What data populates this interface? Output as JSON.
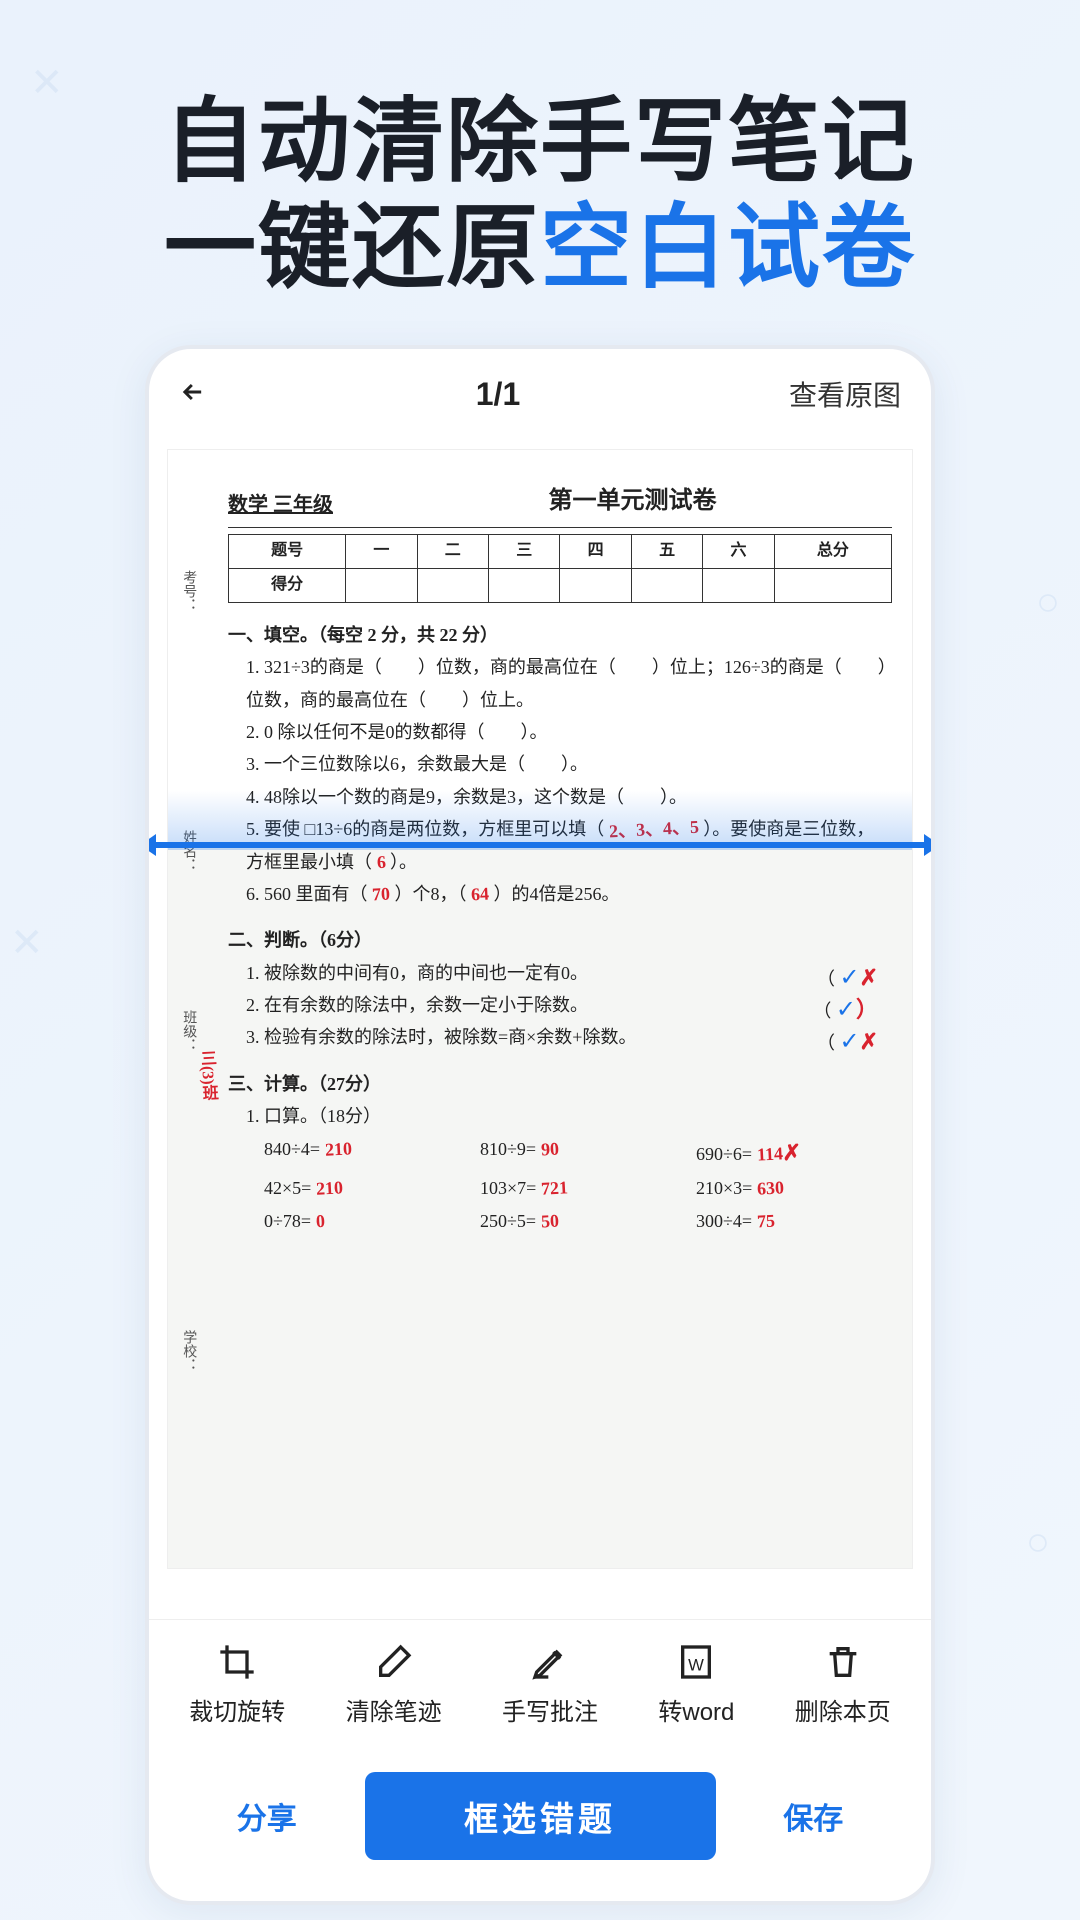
{
  "headline": {
    "line1": "自动清除手写笔记",
    "line2_pre": "一键还原",
    "line2_accent": "空白试卷"
  },
  "topbar": {
    "page_counter": "1/1",
    "view_original": "查看原图"
  },
  "document": {
    "subject": "数学 三年级",
    "unit_title": "第一单元测试卷",
    "score_headers": [
      "题号",
      "一",
      "二",
      "三",
      "四",
      "五",
      "六",
      "总分"
    ],
    "score_row_label": "得分",
    "side": {
      "xuehao": "考号：",
      "xingming": "姓名：",
      "banji": "班级：",
      "xuexiao": "学校：",
      "class_val": "三(3)班"
    },
    "sec1": {
      "title": "一、填空。（每空 2 分，共 22 分）",
      "q1": "1. 321÷3的商是（　　）位数，商的最高位在（　　）位上；126÷3的商是（　　）位数，商的最高位在（　　）位上。",
      "q2": "2. 0 除以任何不是0的数都得（　　）。",
      "q3": "3. 一个三位数除以6，余数最大是（　　）。",
      "q4": "4. 48除以一个数的商是9，余数是3，这个数是（　　）。",
      "q5_a": "5. 要使 □13÷6的商是两位数，方框里可以填（",
      "q5_b": "）。要使商是三位数，方框里最小填（",
      "q5_c": "）。",
      "q6_a": "6. 560 里面有（",
      "q6_b": "）个8，（",
      "q6_c": "）的4倍是256。",
      "hand_q5_fill": "2、3、4、5",
      "hand_q5_min": "6",
      "hand_q6_a": "70",
      "hand_q6_b": "64"
    },
    "sec2": {
      "title": "二、判断。（6分）",
      "q1": "1. 被除数的中间有0，商的中间也一定有0。",
      "q2": "2. 在有余数的除法中，余数一定小于除数。",
      "q3": "3. 检验有余数的除法时，被除数=商×余数+除数。"
    },
    "sec3": {
      "title": "三、计算。（27分）",
      "sub": "1. 口算。（18分）",
      "rows": [
        {
          "a": "840÷4=",
          "av": "210",
          "b": "810÷9=",
          "bv": "90",
          "c": "690÷6=",
          "cv": "114",
          "wrong": true
        },
        {
          "a": "42×5=",
          "av": "210",
          "b": "103×7=",
          "bv": "721",
          "c": "210×3=",
          "cv": "630"
        },
        {
          "a": "0÷78=",
          "av": "0",
          "b": "250÷5=",
          "bv": "50",
          "c": "300÷4=",
          "cv": "75"
        }
      ]
    }
  },
  "toolbar": {
    "crop": "裁切旋转",
    "erase": "清除笔迹",
    "annotate": "手写批注",
    "word": "转word",
    "delete": "删除本页"
  },
  "bottombar": {
    "share": "分享",
    "select_wrong": "框选错题",
    "save": "保存"
  }
}
